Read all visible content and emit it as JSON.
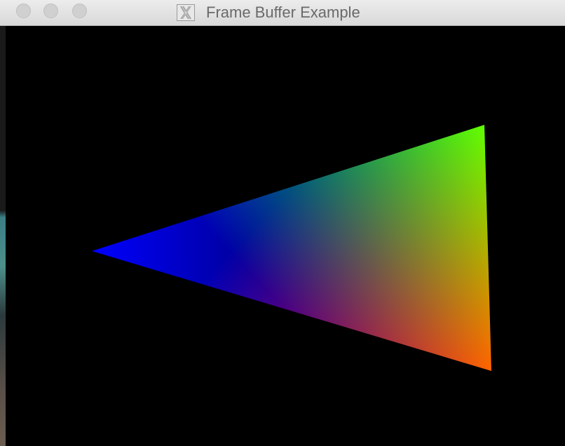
{
  "window": {
    "title": "Frame Buffer Example",
    "app_icon": "x11-icon"
  },
  "titlebar": {
    "buttons": [
      "close",
      "minimize",
      "zoom"
    ],
    "button_color": "#d0d0d0"
  },
  "framebuffer": {
    "background": "#000000",
    "triangle": {
      "vertex_colors": {
        "left": "#0000ff",
        "top_right": "#00ff00",
        "bottom_right": "#ff0000"
      }
    }
  }
}
